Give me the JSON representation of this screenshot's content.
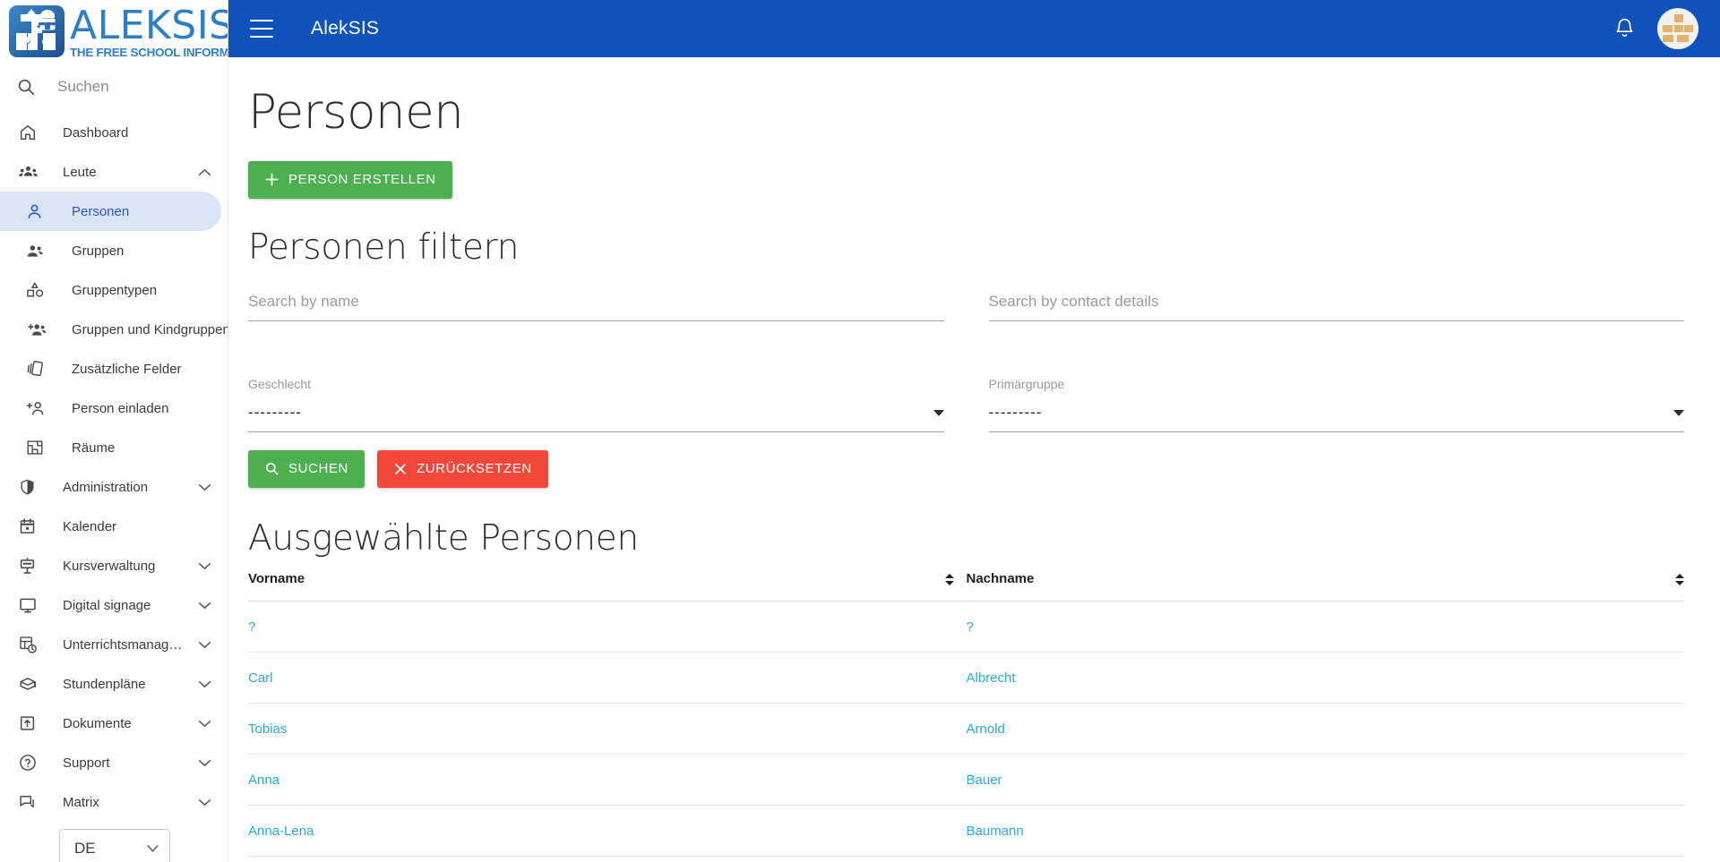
{
  "brand": {
    "word": "ALEKSIS",
    "tagline": "THE FREE SCHOOL INFORMATION SYSTEM"
  },
  "appbar": {
    "title": "AlekSIS",
    "menu_icon": "hamburger-icon",
    "notifications_icon": "bell-icon",
    "avatar_label": "identicon-avatar"
  },
  "sidebar": {
    "search_placeholder": "Suchen",
    "language": {
      "value": "DE"
    },
    "items": [
      {
        "label": "Dashboard",
        "icon": "home-icon",
        "level": 0,
        "expandable": false,
        "active": false
      },
      {
        "label": "Leute",
        "icon": "people-group-icon",
        "level": 0,
        "expandable": true,
        "expanded": true,
        "active": false
      },
      {
        "label": "Personen",
        "icon": "person-icon",
        "level": 1,
        "expandable": false,
        "active": true
      },
      {
        "label": "Gruppen",
        "icon": "group-icon",
        "level": 1,
        "expandable": false,
        "active": false
      },
      {
        "label": "Gruppentypen",
        "icon": "shapes-icon",
        "level": 1,
        "expandable": false,
        "active": false
      },
      {
        "label": "Gruppen und Kindgruppen",
        "icon": "group-add-icon",
        "level": 1,
        "expandable": false,
        "active": false
      },
      {
        "label": "Zusätzliche Felder",
        "icon": "layers-icon",
        "level": 1,
        "expandable": false,
        "active": false
      },
      {
        "label": "Person einladen",
        "icon": "person-add-icon",
        "level": 1,
        "expandable": false,
        "active": false
      },
      {
        "label": "Räume",
        "icon": "room-icon",
        "level": 1,
        "expandable": false,
        "active": false
      },
      {
        "label": "Administration",
        "icon": "shield-icon",
        "level": 0,
        "expandable": true,
        "expanded": false,
        "active": false
      },
      {
        "label": "Kalender",
        "icon": "calendar-icon",
        "level": 0,
        "expandable": false,
        "active": false
      },
      {
        "label": "Kursverwaltung",
        "icon": "presentation-icon",
        "level": 0,
        "expandable": true,
        "expanded": false,
        "active": false
      },
      {
        "label": "Digital signage",
        "icon": "monitor-icon",
        "level": 0,
        "expandable": true,
        "expanded": false,
        "active": false
      },
      {
        "label": "Unterrichtsmanag…",
        "icon": "schedule-icon",
        "level": 0,
        "expandable": true,
        "expanded": false,
        "active": false
      },
      {
        "label": "Stundenpläne",
        "icon": "graduation-cap-icon",
        "level": 0,
        "expandable": true,
        "expanded": false,
        "active": false
      },
      {
        "label": "Dokumente",
        "icon": "upload-box-icon",
        "level": 0,
        "expandable": true,
        "expanded": false,
        "active": false
      },
      {
        "label": "Support",
        "icon": "help-circle-icon",
        "level": 0,
        "expandable": true,
        "expanded": false,
        "active": false
      },
      {
        "label": "Matrix",
        "icon": "chat-icon",
        "level": 0,
        "expandable": true,
        "expanded": false,
        "active": false
      }
    ]
  },
  "main": {
    "page_title": "Personen",
    "create_button": {
      "label": "PERSON ERSTELLEN",
      "icon": "plus-icon"
    },
    "filter": {
      "title": "Personen filtern",
      "name_search": {
        "placeholder": "Search by name",
        "value": ""
      },
      "contact_search": {
        "placeholder": "Search by contact details",
        "value": ""
      },
      "gender": {
        "label": "Geschlecht",
        "value": "---------"
      },
      "primary_group": {
        "label": "Primärgruppe",
        "value": "---------"
      },
      "search_button": {
        "label": "SUCHEN",
        "icon": "search-icon"
      },
      "reset_button": {
        "label": "ZURÜCKSETZEN",
        "icon": "close-icon"
      }
    },
    "results": {
      "title": "Ausgewählte Personen",
      "columns": [
        {
          "label": "Vorname",
          "sortable": true
        },
        {
          "label": "Nachname",
          "sortable": true
        }
      ],
      "rows": [
        {
          "first_name": "?",
          "last_name": "?"
        },
        {
          "first_name": "Carl",
          "last_name": "Albrecht"
        },
        {
          "first_name": "Tobias",
          "last_name": "Arnold"
        },
        {
          "first_name": "Anna",
          "last_name": "Bauer"
        },
        {
          "first_name": "Anna-Lena",
          "last_name": "Baumann"
        }
      ]
    }
  },
  "colors": {
    "appbar_blue": "#0f52ba",
    "brand_blue": "#2f7fc4",
    "active_nav_bg": "#dbe4f5",
    "active_nav_text": "#2a56c6",
    "green": "#4caf50",
    "red": "#f4473b",
    "link_blue": "#29a7e8"
  }
}
